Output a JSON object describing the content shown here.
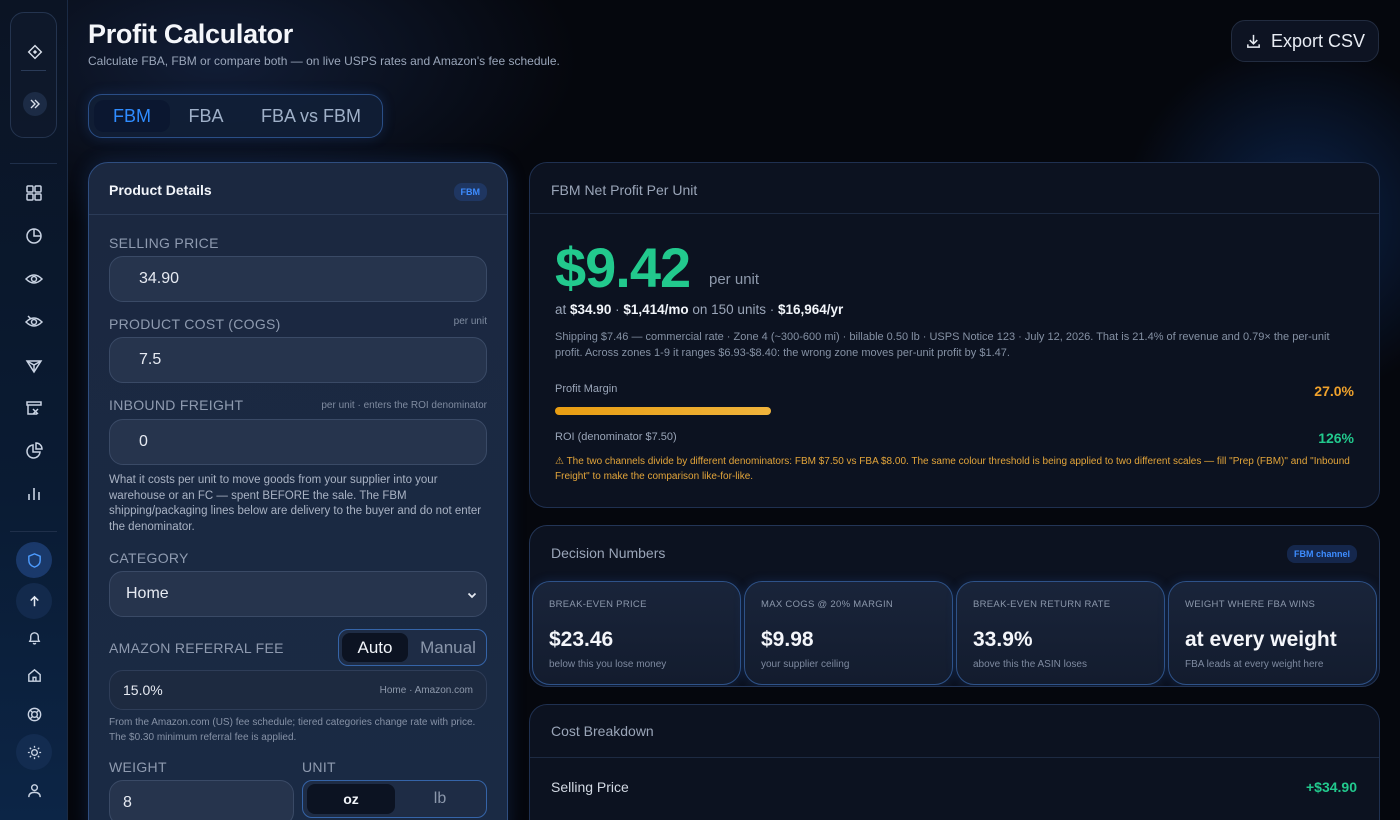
{
  "header": {
    "title": "Profit Calculator",
    "subtitle": "Calculate FBA, FBM or compare both — on live USPS rates and Amazon's fee schedule.",
    "export_label": "Export CSV"
  },
  "mode_tabs": [
    "FBM",
    "FBA",
    "FBA vs FBM"
  ],
  "mode_active": "FBM",
  "sidebar": {
    "icons": [
      "diamond-icon",
      "expand-icon",
      "grid-icon",
      "pie-chart-icon",
      "eye-icon",
      "eye-slash-icon",
      "gem-icon",
      "box-icon",
      "pie-icon",
      "bar-chart-icon",
      "shield-icon",
      "arrow-up-icon",
      "bell-icon",
      "home-icon",
      "lifebuoy-icon",
      "sun-icon",
      "user-icon"
    ]
  },
  "product": {
    "title": "Product Details",
    "badge": "FBM",
    "selling_price_label": "SELLING PRICE",
    "selling_price": "34.90",
    "cogs_label": "PRODUCT COST (COGS)",
    "cogs_hint": "per unit",
    "cogs": "7.5",
    "freight_label": "INBOUND FREIGHT",
    "freight_hint": "per unit · enters the ROI denominator",
    "freight": "0",
    "freight_note": "What it costs per unit to move goods from your supplier into your warehouse or an FC — spent BEFORE the sale. The FBM shipping/packaging lines below are delivery to the buyer and do not enter the denominator.",
    "category_label": "CATEGORY",
    "category": "Home",
    "referral_label": "AMAZON REFERRAL FEE",
    "referral_modes": [
      "Auto",
      "Manual"
    ],
    "referral_mode_active": "Auto",
    "referral_value": "15.0%",
    "referral_source": "Home · Amazon.com",
    "referral_note": "From the Amazon.com (US) fee schedule; tiered categories change rate with price. The $0.30 minimum referral fee is applied.",
    "weight_label": "WEIGHT",
    "weight": "8",
    "unit_label": "UNIT",
    "units": [
      "oz",
      "lb"
    ],
    "unit_active": "oz"
  },
  "result": {
    "title": "FBM Net Profit Per Unit",
    "profit": "$9.42",
    "per_unit": "per unit",
    "at": "at",
    "price": "$34.90",
    "monthly": "$1,414/mo",
    "on_units": "on 150 units ·",
    "yearly": "$16,964/yr",
    "detail": "Shipping $7.46 — commercial rate · Zone 4 (~300-600 mi) · billable 0.50 lb · USPS Notice 123 · July 12, 2026. That is 21.4% of revenue and 0.79× the per-unit profit. Across zones 1-9 it ranges $6.93-$8.40: the wrong zone moves per-unit profit by $1.47.",
    "margin_label": "Profit Margin",
    "margin": "27.0%",
    "margin_fraction": 0.27,
    "roi_label": "ROI (denominator $7.50)",
    "roi": "126%",
    "warning": "⚠ The two channels divide by different denominators: FBM $7.50 vs FBA $8.00. The same colour threshold is being applied to two different scales — fill \"Prep (FBM)\" and \"Inbound Freight\" to make the comparison like-for-like."
  },
  "decision": {
    "title": "Decision Numbers",
    "badge": "FBM channel",
    "cards": [
      {
        "key": "BREAK-EVEN PRICE",
        "value": "$23.46",
        "sub": "below this you lose money"
      },
      {
        "key": "MAX COGS @ 20% MARGIN",
        "value": "$9.98",
        "sub": "your supplier ceiling"
      },
      {
        "key": "BREAK-EVEN RETURN RATE",
        "value": "33.9%",
        "sub": "above this the ASIN loses"
      },
      {
        "key": "WEIGHT WHERE FBA WINS",
        "value": "at every weight",
        "sub": "FBA leads at every weight here"
      }
    ]
  },
  "breakdown": {
    "title": "Cost Breakdown",
    "rows": [
      {
        "label": "Selling Price",
        "value": "+$34.90"
      }
    ]
  },
  "colors": {
    "accent_blue": "#2f8cff",
    "profit_green": "#22c98d",
    "warning_orange": "#e3a53a",
    "margin_orange": "#f0a22c"
  }
}
